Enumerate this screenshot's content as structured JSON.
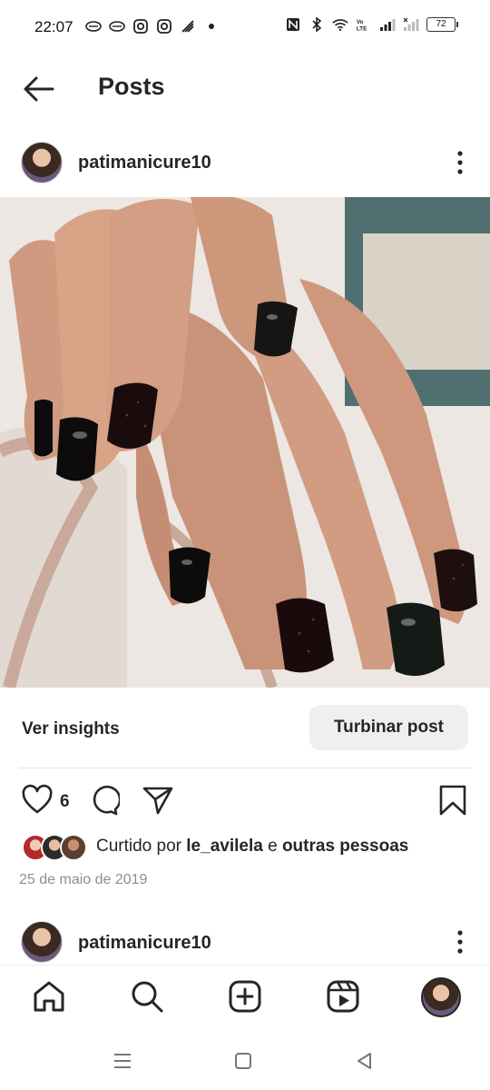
{
  "status_bar": {
    "time": "22:07",
    "battery": "72",
    "left_icons": [
      "notification-icon",
      "notification-icon",
      "instagram-icon",
      "instagram-icon",
      "signal-app-icon",
      "dot-icon"
    ],
    "right_icons": [
      "nfc-icon",
      "bluetooth-icon",
      "wifi-icon",
      "volte-icon",
      "signal-icon",
      "signal-icon"
    ]
  },
  "header": {
    "title": "Posts",
    "back_icon": "arrow-left-icon"
  },
  "post": {
    "username": "patimanicure10",
    "image_description_icon": "photo",
    "insights_label": "Ver insights",
    "boost_label": "Turbinar post",
    "like_count": "6",
    "liked_by_prefix": "Curtido por",
    "liked_by_user": "le_avilela",
    "liked_by_connector": "e",
    "liked_by_others": "outras pessoas",
    "date": "25 de maio de 2019"
  },
  "next_post": {
    "username": "patimanicure10"
  },
  "colors": {
    "text": "#262626",
    "muted": "#8e8e8e",
    "button_bg": "#efeff1",
    "nail_black": "#0d0b0b"
  }
}
